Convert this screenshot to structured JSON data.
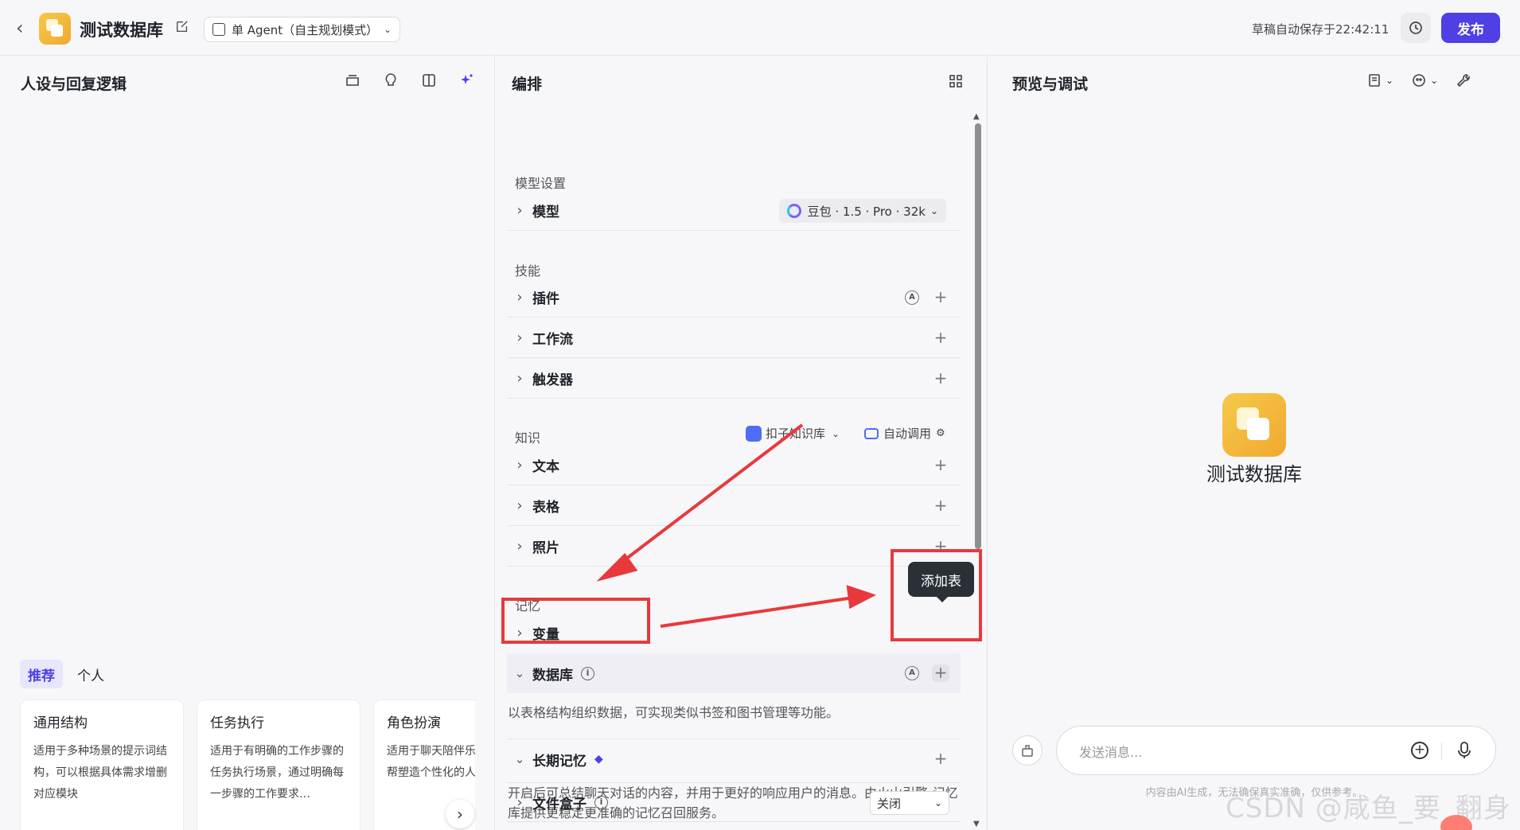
{
  "header": {
    "back_icon": "chevron-left-icon",
    "app_title": "测试数据库",
    "mode_label": "单 Agent（自主规划模式）",
    "autosave": "草稿自动保存于22:42:11",
    "publish_label": "发布"
  },
  "left": {
    "title": "人设与回复逻辑",
    "tabs": [
      "推荐",
      "个人"
    ],
    "cards": [
      {
        "title": "通用结构",
        "desc": "适用于多种场景的提示词结构，可以根据具体需求增删对应模块"
      },
      {
        "title": "任务执行",
        "desc": "适用于有明确的工作步骤的任务执行场景，通过明确每一步骤的工作要求…"
      },
      {
        "title": "角色扮演",
        "desc": "适用于聊天陪伴乐场景，可帮塑造个性化的人"
      }
    ]
  },
  "mid": {
    "title": "编排",
    "sections": {
      "model": "模型设置",
      "skills": "技能",
      "knowledge": "知识",
      "memory": "记忆"
    },
    "model_row": {
      "label": "模型",
      "value": "豆包 · 1.5 · Pro · 32k"
    },
    "skills_rows": [
      "插件",
      "工作流",
      "触发器"
    ],
    "kb_source": "扣子知识库",
    "kb_mode": "自动调用",
    "knowledge_rows": [
      "文本",
      "表格",
      "照片"
    ],
    "memory_rows": {
      "variable": "变量",
      "database": "数据库",
      "database_desc": "以表格结构组织数据，可实现类似书签和图书管理等功能。",
      "long_memory": "长期记忆",
      "long_memory_desc": "开启后可总结聊天对话的内容，并用于更好的响应用户的消息。由火山引擎-记忆库提供更稳定更准确的记忆召回服务。",
      "file_box": "文件盒子",
      "file_box_value": "关闭"
    },
    "tooltip": "添加表"
  },
  "right": {
    "title": "预览与调试",
    "bot_name": "测试数据库",
    "input_placeholder": "发送消息...",
    "disclaimer": "内容由AI生成，无法确保真实准确，仅供参考。",
    "watermark": "CSDN @咸鱼_要_翻身"
  },
  "colors": {
    "accent": "#4e40e5",
    "annotation_red": "#e8393c",
    "app_icon": "#f3b93c"
  }
}
